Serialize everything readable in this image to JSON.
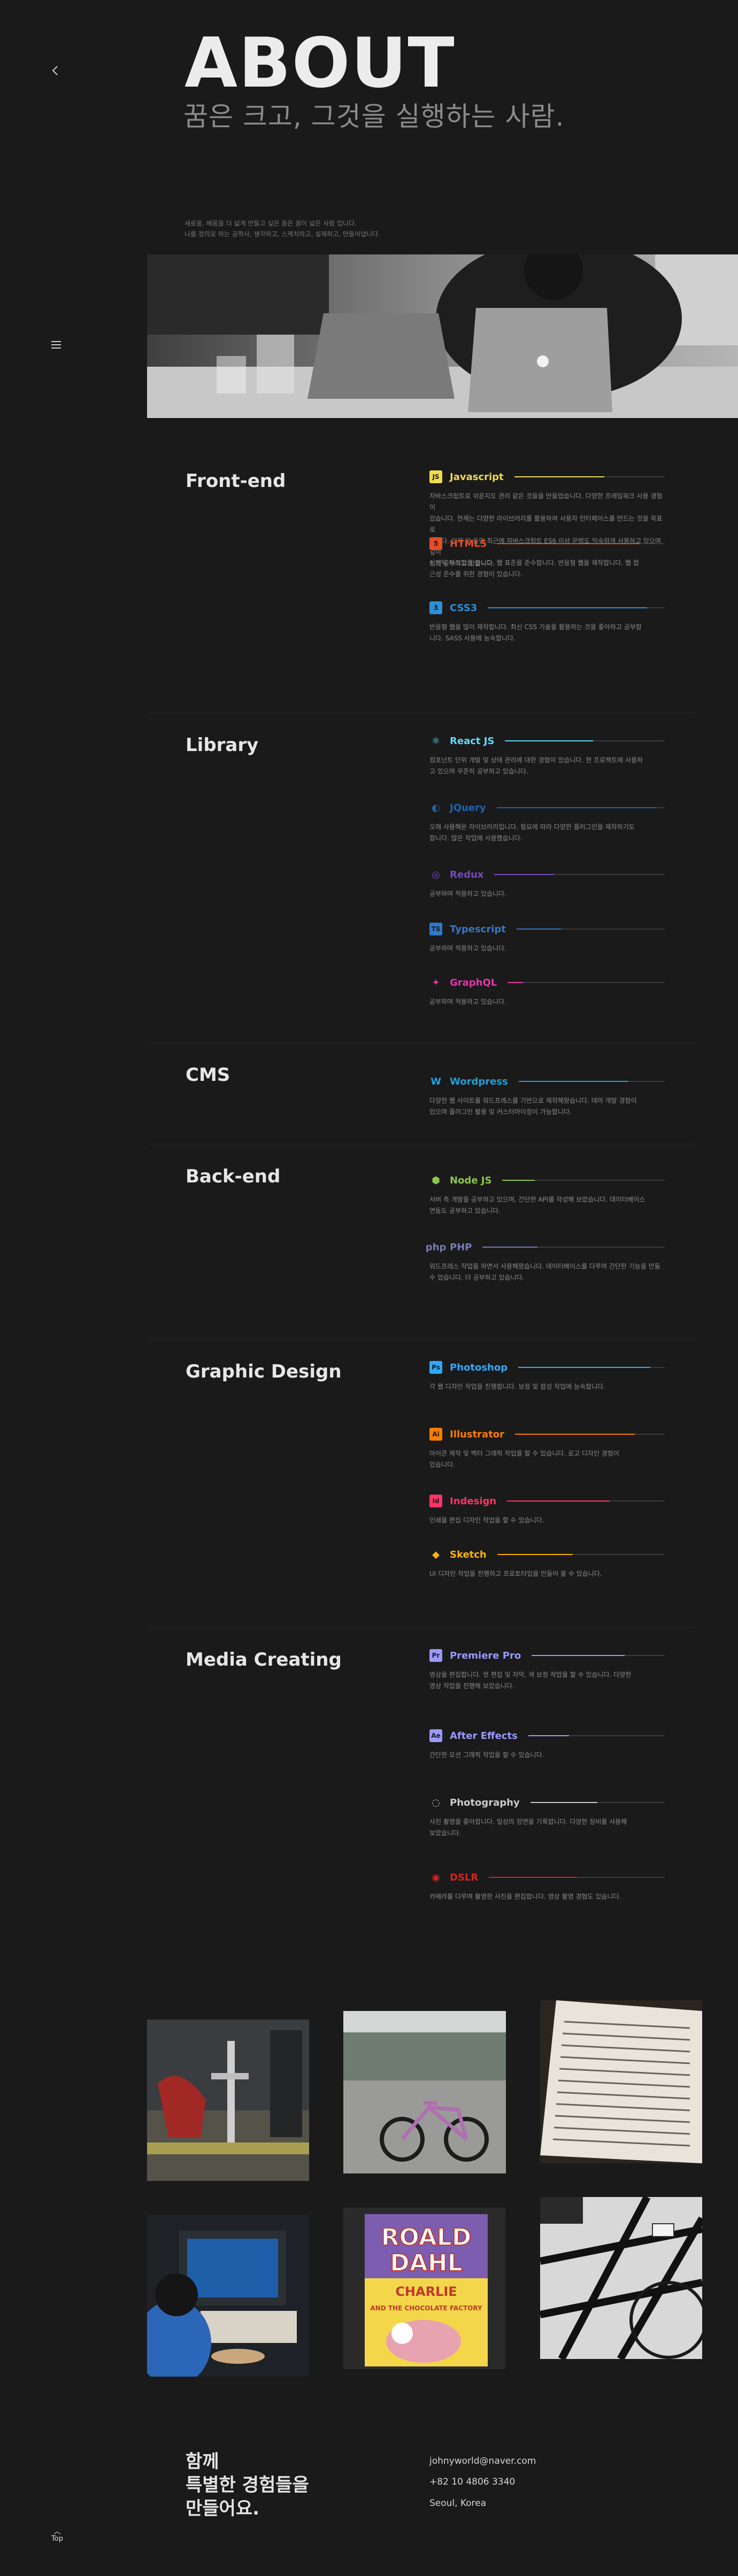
{
  "nav": {
    "back_icon": "chevron-left-icon",
    "menu_icon": "hamburger-icon",
    "top_label": "Top"
  },
  "hero": {
    "title": "ABOUT",
    "subtitle": "꿈은 크고, 그것을 실행하는 사람."
  },
  "intro": {
    "lines": [
      "새로움, 배움을 더 넓게 만들고 싶은 꿈은 꿈이 넓은 사람 입니다.",
      "나를 정의로 하는 공학사, 생각하고, 스케치하고, 실제하고, 만들어냅니다."
    ]
  },
  "sections": [
    {
      "title": "Front-end",
      "skills": [
        {
          "name": "Javascript",
          "icon": "js-icon",
          "color": "#f0db4f",
          "level": 0.6,
          "desc": [
            "자바스크립트로 쉬운지도 관리 같은 것들을 만들었습니다. 다양한 프레임워크 사용 경험이",
            "있습니다. 현재는 다양한 라이브러리를 활용하여 사용자 인터페이스를 만드는 것을 목표로",
            "합니다. 이제 분 동안 최근에 자바스크립트 ES6 이상 문법도 익숙하게 사용하고 있으며 깊이",
            "있게 공부하고 있습니다."
          ]
        },
        {
          "name": "HTML5",
          "icon": "html5-icon",
          "color": "#e34c26",
          "level": 0.85,
          "desc": [
            "시맨틱 마크업을 합니다. 웹 표준을 준수합니다. 반응형 웹을 제작합니다. 웹 접",
            "근성 준수를 위한 경험이 있습니다."
          ]
        },
        {
          "name": "CSS3",
          "icon": "css3-icon",
          "color": "#2d8fd5",
          "level": 0.9,
          "desc": [
            "반응형 웹을 많이 제작합니다. 최신 CSS 기술을 활용하는 것을 좋아하고 공부합",
            "니다. SASS 사용에 능숙합니다."
          ]
        }
      ]
    },
    {
      "title": "Library",
      "skills": [
        {
          "name": "React JS",
          "icon": "react-icon",
          "color": "#61dafb",
          "level": 0.55,
          "desc": [
            "컴포넌트 단위 개발 및 상태 관리에 대한 경험이 있습니다. 현 프로젝트에 사용하",
            "고 있으며 꾸준히 공부하고 있습니다."
          ]
        },
        {
          "name": "JQuery",
          "icon": "jquery-icon",
          "color": "#1e64b0",
          "level": 0.95,
          "desc": [
            "오래 사용해온 라이브러리입니다. 필요에 따라 다양한 플러그인을 제작하기도",
            "합니다. 많은 작업에 사용했습니다."
          ]
        },
        {
          "name": "Redux",
          "icon": "redux-icon",
          "color": "#764abc",
          "level": 0.35,
          "desc": [
            "공부하며 적용하고 있습니다."
          ]
        },
        {
          "name": "Typescript",
          "icon": "ts-icon",
          "color": "#3178c6",
          "level": 0.3,
          "desc": [
            "공부하며 적용하고 있습니다."
          ]
        },
        {
          "name": "GraphQL",
          "icon": "graphql-icon",
          "color": "#e535ab",
          "level": 0.1,
          "desc": [
            "공부하며 적용하고 있습니다."
          ]
        }
      ]
    },
    {
      "title": "CMS",
      "skills": [
        {
          "name": "Wordpress",
          "icon": "wordpress-icon",
          "color": "#21a0d6",
          "level": 0.75,
          "desc": [
            "다양한 웹 사이트를 워드프레스를 기반으로 제작해왔습니다. 테마 개발 경험이",
            "있으며 플러그인 활용 및 커스터마이징이 가능합니다."
          ]
        }
      ]
    },
    {
      "title": "Back-end",
      "skills": [
        {
          "name": "Node JS",
          "icon": "nodejs-icon",
          "color": "#8cc84b",
          "level": 0.2,
          "desc": [
            "서버 측 개발을 공부하고 있으며, 간단한 API를 작성해 보았습니다. 데이터베이스",
            "연동도 공부하고 있습니다."
          ]
        },
        {
          "name": "PHP",
          "icon": "php-icon",
          "color": "#777bb3",
          "level": 0.3,
          "desc": [
            "워드프레스 작업을 하면서 사용해왔습니다. 데이터베이스를 다루며 간단한 기능을 만들",
            "수 있습니다. 더 공부하고 있습니다."
          ]
        }
      ]
    },
    {
      "title": "Graphic Design",
      "skills": [
        {
          "name": "Photoshop",
          "icon": "photoshop-icon",
          "color": "#31a8ff",
          "level": 0.9,
          "desc": [
            "각 웹 디자인 작업을 진행합니다. 보정 및 합성 작업에 능숙합니다."
          ]
        },
        {
          "name": "Illustrator",
          "icon": "illustrator-icon",
          "color": "#ff7c00",
          "level": 0.8,
          "desc": [
            "아이콘 제작 및 벡터 그래픽 작업을 할 수 있습니다. 로고 디자인 경험이",
            "있습니다."
          ]
        },
        {
          "name": "Indesign",
          "icon": "indesign-icon",
          "color": "#ff3366",
          "level": 0.65,
          "desc": [
            "인쇄물 편집 디자인 작업을 할 수 있습니다."
          ]
        },
        {
          "name": "Sketch",
          "icon": "sketch-icon",
          "color": "#fdb300",
          "level": 0.45,
          "desc": [
            "UI 디자인 작업을 진행하고 프로토타입을 만들어 볼 수 있습니다."
          ]
        }
      ]
    },
    {
      "title": "Media Creating",
      "skills": [
        {
          "name": "Premiere Pro",
          "icon": "premiere-icon",
          "color": "#9999ff",
          "level": 0.7,
          "desc": [
            "영상을 편집합니다. 컷 편집 및 자막, 색 보정 작업을 할 수 있습니다. 다양한",
            "영상 작업을 진행해 보았습니다."
          ]
        },
        {
          "name": "After Effects",
          "icon": "aftereffects-icon",
          "color": "#9999ff",
          "level": 0.3,
          "desc": [
            "간단한 모션 그래픽 작업을 할 수 있습니다."
          ]
        },
        {
          "name": "Photography",
          "icon": "aperture-icon",
          "color": "#cccccc",
          "level": 0.5,
          "desc": [
            "사진 촬영을 좋아합니다. 일상의 장면을 기록합니다. 다양한 장비를 사용해",
            "보았습니다."
          ]
        },
        {
          "name": "DSLR",
          "icon": "dslr-icon",
          "color": "#d9231d",
          "level": 0.5,
          "desc": [
            "카메라를 다루며 촬영한 사진을 편집합니다. 영상 촬영 경험도 있습니다."
          ]
        }
      ]
    }
  ],
  "footer": {
    "title_lines": [
      "함께",
      "특별한 경험들을",
      "만들어요."
    ],
    "email": "johnyworld@naver.com",
    "phone": "+82 10 4806 3340",
    "location": "Seoul, Korea"
  }
}
